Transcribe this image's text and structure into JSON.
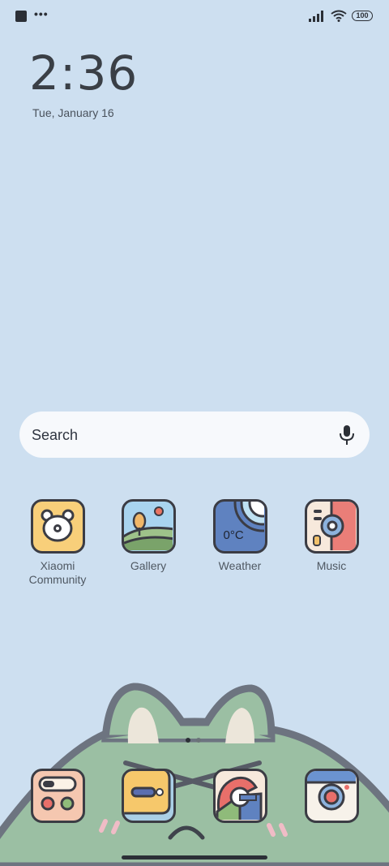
{
  "status_bar": {
    "battery": "100",
    "icons": [
      "stop-square-icon",
      "more-dots-icon",
      "signal-icon",
      "wifi-icon",
      "battery-icon"
    ]
  },
  "clock": {
    "time": "2:36",
    "date": "Tue, January 16"
  },
  "search": {
    "label": "Search",
    "icon": "microphone-icon"
  },
  "apps": [
    {
      "name": "Xiaomi Community",
      "icon": "xiaomi-community-icon"
    },
    {
      "name": "Gallery",
      "icon": "gallery-icon"
    },
    {
      "name": "Weather",
      "icon": "weather-icon",
      "badge": "0°C"
    },
    {
      "name": "Music",
      "icon": "music-icon"
    }
  ],
  "dock": [
    {
      "icon": "phone-dialer-icon"
    },
    {
      "icon": "messages-icon"
    },
    {
      "icon": "chrome-browser-icon"
    },
    {
      "icon": "camera-icon"
    }
  ],
  "colors": {
    "wallpaper": "#cddff0",
    "frog_green": "#9bbfa3",
    "outline": "#3b3c44"
  }
}
